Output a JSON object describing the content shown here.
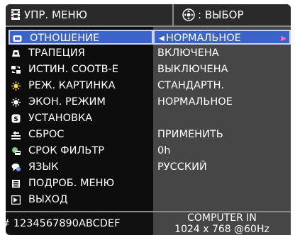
{
  "header": {
    "menu_title": "УПР. МЕНЮ",
    "select_label": ": ВЫБОР",
    "menu_icon": "film-icon",
    "select_icon": "dpad-icon"
  },
  "menu": {
    "items": [
      {
        "label": "ОТНОШЕНИЕ",
        "icon": "aspect-icon",
        "value": "НОРМАЛЬНОЕ"
      },
      {
        "label": "ТРАПЕЦИЯ",
        "icon": "keystone-icon",
        "value": "ВКЛЮЧЕНА"
      },
      {
        "label": "ИСТИН. СООТВ-Е",
        "icon": "match-icon",
        "value": "ВЫКЛЮЧЕНА"
      },
      {
        "label": "РЕЖ. КАРТИНКА",
        "icon": "picture-mode-icon",
        "value": "СТАНДАРТН."
      },
      {
        "label": "ЭКОН. РЕЖИМ",
        "icon": "eco-mode-icon",
        "value": "НОРМАЛЬНОЕ"
      },
      {
        "label": "УСТАНОВКА",
        "icon": "setup-icon",
        "value": ""
      },
      {
        "label": "СБРОС",
        "icon": "reset-icon",
        "value": "ПРИМЕНИТЬ"
      },
      {
        "label": "СРОК ФИЛЬТР",
        "icon": "filter-icon",
        "value": "0h"
      },
      {
        "label": "ЯЗЫК",
        "icon": "language-icon",
        "value": "РУССКИЙ"
      },
      {
        "label": "ПОДРОБ. МЕНЮ",
        "icon": "advanced-menu-icon",
        "value": ""
      },
      {
        "label": "ВЫХОД",
        "icon": "exit-icon",
        "value": ""
      }
    ]
  },
  "footer": {
    "serial": "# 1234567890ABCDEF",
    "input_name": "COMPUTER IN",
    "resolution": "1024 x 768 @60Hz"
  },
  "colors": {
    "highlight": "#3b63c9",
    "panel_dark": "#111111",
    "panel_gray": "#464646"
  }
}
